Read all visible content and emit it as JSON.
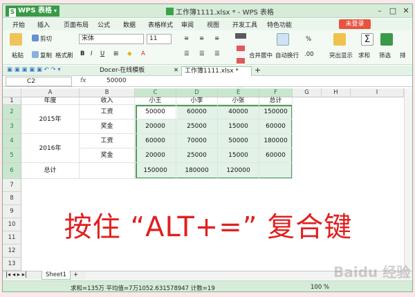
{
  "app": {
    "name": "WPS 表格",
    "doc_title": "工作簿1111.xlsx * - WPS 表格",
    "login": "未登录"
  },
  "menu": [
    "开始",
    "插入",
    "页面布局",
    "公式",
    "数据",
    "表格样式",
    "审阅",
    "视图",
    "开发工具",
    "特色功能"
  ],
  "ribbon": {
    "cut": "剪切",
    "copy": "复制",
    "format_painter": "格式刷",
    "paste": "粘贴",
    "font": "宋体",
    "size": "11",
    "merge": "合并居中",
    "wrap": "自动换行",
    "percent": "%",
    "freeze": "突出显示",
    "sum": "求和",
    "filter": "筛选",
    "sort": "排"
  },
  "tabs": [
    {
      "label": "Docer-在线模板"
    },
    {
      "label": "工作簿1111.xlsx *"
    }
  ],
  "formula": {
    "cell": "C2",
    "fx": "fx",
    "value": "50000"
  },
  "columns": [
    "A",
    "B",
    "C",
    "D",
    "E",
    "F",
    "G",
    "H",
    "I"
  ],
  "rows": [
    "1",
    "2",
    "3",
    "4",
    "5",
    "6",
    "7",
    "8",
    "9",
    "10",
    "11",
    "12",
    "13"
  ],
  "cells": {
    "r1": [
      "年度",
      "收入",
      "小王",
      "小李",
      "小张",
      "总计"
    ],
    "r2": [
      "2015年",
      "工资",
      "50000",
      "60000",
      "40000",
      "150000"
    ],
    "r3": [
      "",
      "奖金",
      "20000",
      "25000",
      "15000",
      "60000"
    ],
    "r4": [
      "2016年",
      "工资",
      "60000",
      "70000",
      "50000",
      "180000"
    ],
    "r5": [
      "",
      "奖金",
      "20000",
      "25000",
      "15000",
      "60000"
    ],
    "r6": [
      "总计",
      "",
      "150000",
      "180000",
      "120000",
      ""
    ]
  },
  "sheet": {
    "name": "Sheet1"
  },
  "status": {
    "text": "求和=135万  平均值=7万1052.631578947  计数=19",
    "zoom": "100 %"
  },
  "overlay_text": "按住 “ALT+=” 复合键",
  "watermark": "Baidu 经验",
  "colors": {
    "accent": "#3a9a48",
    "selection": "#e3f2e6",
    "overlay": "#e02020",
    "login": "#e8533f"
  }
}
